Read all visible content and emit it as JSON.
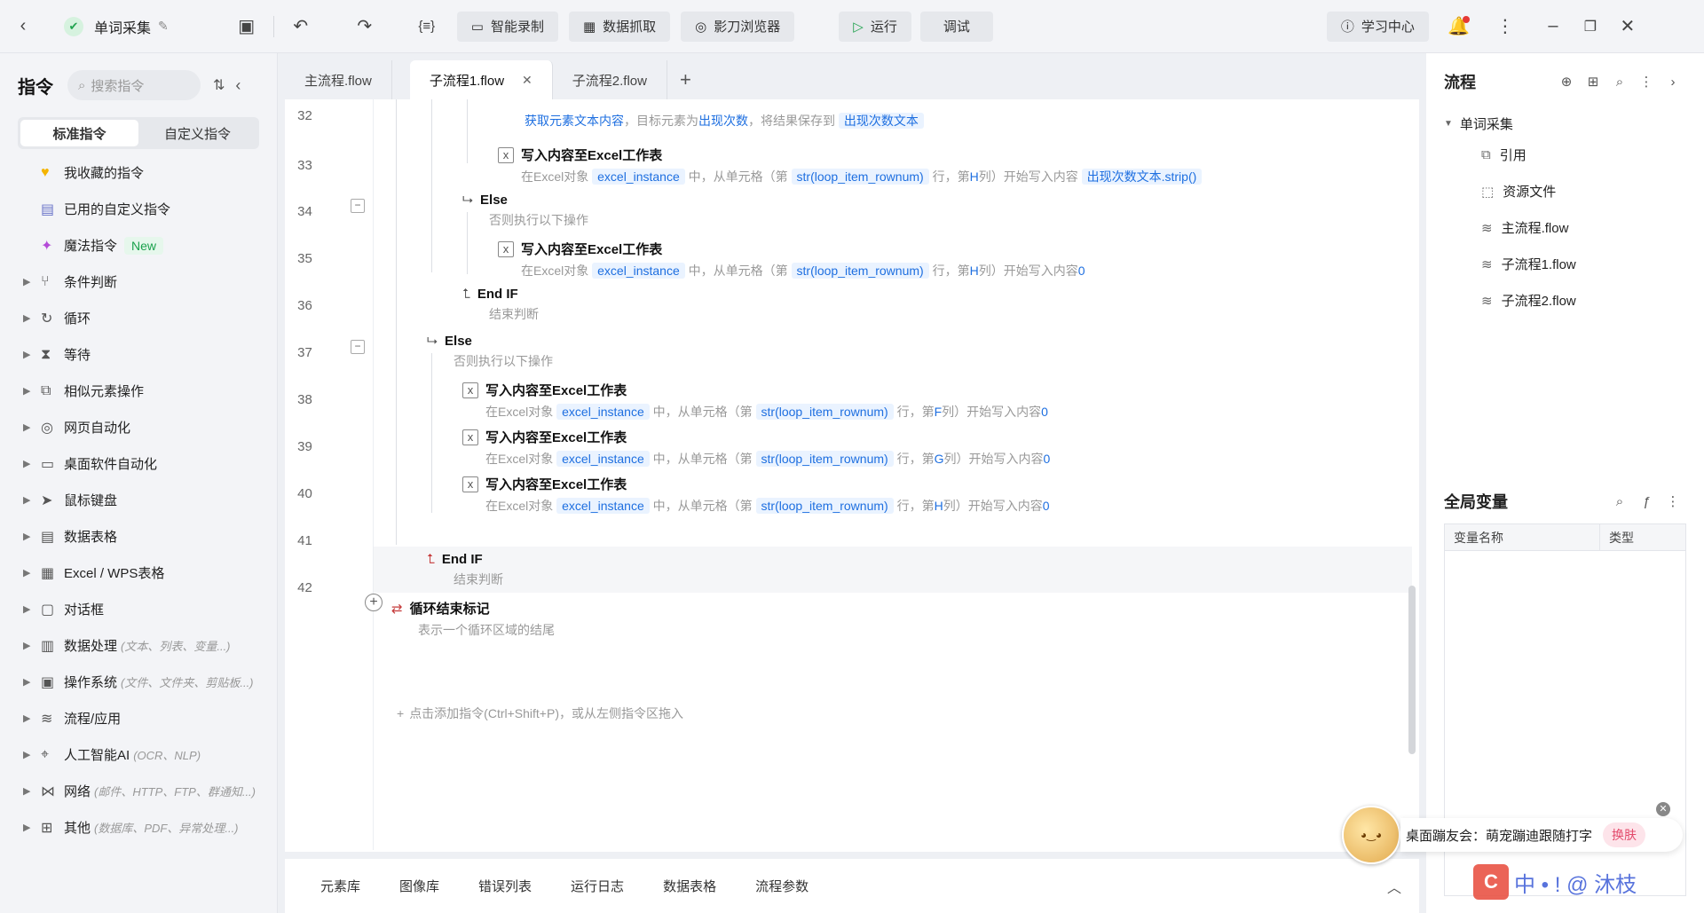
{
  "topbar": {
    "project_name": "单词采集",
    "record": "智能录制",
    "capture": "数据抓取",
    "browser": "影刀浏览器",
    "run": "运行",
    "debug": "调试",
    "learn": "学习中心"
  },
  "left": {
    "title": "指令",
    "search_placeholder": "搜索指令",
    "seg_standard": "标准指令",
    "seg_custom": "自定义指令",
    "items": [
      {
        "label": "我收藏的指令",
        "icon": "heart-icon",
        "arrow": false
      },
      {
        "label": "已用的自定义指令",
        "icon": "calendar-icon",
        "arrow": false
      },
      {
        "label": "魔法指令",
        "icon": "sparkle-icon",
        "arrow": false,
        "badge": "New"
      },
      {
        "label": "条件判断",
        "icon": "branch-icon",
        "arrow": true
      },
      {
        "label": "循环",
        "icon": "loop-icon",
        "arrow": true
      },
      {
        "label": "等待",
        "icon": "hourglass-icon",
        "arrow": true
      },
      {
        "label": "相似元素操作",
        "icon": "copy-icon",
        "arrow": true
      },
      {
        "label": "网页自动化",
        "icon": "chrome-icon",
        "arrow": true
      },
      {
        "label": "桌面软件自动化",
        "icon": "monitor-icon",
        "arrow": true
      },
      {
        "label": "鼠标键盘",
        "icon": "cursor-icon",
        "arrow": true
      },
      {
        "label": "数据表格",
        "icon": "table-icon",
        "arrow": true
      },
      {
        "label": "Excel / WPS表格",
        "icon": "excel-icon",
        "arrow": true
      },
      {
        "label": "对话框",
        "icon": "dialog-icon",
        "arrow": true
      },
      {
        "label": "数据处理",
        "icon": "data-icon",
        "arrow": true,
        "hint": "(文本、列表、变量...)"
      },
      {
        "label": "操作系统",
        "icon": "briefcase-icon",
        "arrow": true,
        "hint": "(文件、文件夹、剪贴板...)"
      },
      {
        "label": "流程/应用",
        "icon": "layers-icon",
        "arrow": true
      },
      {
        "label": "人工智能AI",
        "icon": "ai-icon",
        "arrow": true,
        "hint": "(OCR、NLP)"
      },
      {
        "label": "网络",
        "icon": "share-icon",
        "arrow": true,
        "hint": "(邮件、HTTP、FTP、群通知...)"
      },
      {
        "label": "其他",
        "icon": "grid-icon",
        "arrow": true,
        "hint": "(数据库、PDF、异常处理...)"
      }
    ]
  },
  "editor": {
    "tabs": [
      "主流程.flow",
      "子流程1.flow",
      "子流程2.flow"
    ],
    "add_hint": "点击添加指令(Ctrl+Shift+P)，或从左侧指令区拖入",
    "rows": {
      "r32": {
        "ln": "32",
        "desc_a": "获取元素文本内容",
        "desc_b": "，目标元素为",
        "desc_c": "出现次数",
        "desc_d": "，将结果保存到",
        "var": "出现次数文本"
      },
      "r33": {
        "ln": "33",
        "title": "写入内容至Excel工作表",
        "p1": "在Excel对象",
        "v1": "excel_instance",
        "p2": "中，从单元格（第",
        "v2": "str(loop_item_rownum)",
        "p3": "行，第",
        "col": "H",
        "p4": "列）开始写入内容",
        "v3": "出现次数文本.strip()"
      },
      "r34": {
        "ln": "34",
        "title": "Else",
        "desc": "否则执行以下操作"
      },
      "r35": {
        "ln": "35",
        "title": "写入内容至Excel工作表",
        "p1": "在Excel对象",
        "v1": "excel_instance",
        "p2": "中，从单元格（第",
        "v2": "str(loop_item_rownum)",
        "p3": "行，第",
        "col": "H",
        "p4": "列）开始写入内容",
        "val": "0"
      },
      "r36": {
        "ln": "36",
        "title": "End IF",
        "desc": "结束判断"
      },
      "r37": {
        "ln": "37",
        "title": "Else",
        "desc": "否则执行以下操作"
      },
      "r38": {
        "ln": "38",
        "title": "写入内容至Excel工作表",
        "p1": "在Excel对象",
        "v1": "excel_instance",
        "p2": "中，从单元格（第",
        "v2": "str(loop_item_rownum)",
        "p3": "行，第",
        "col": "F",
        "p4": "列）开始写入内容",
        "val": "0"
      },
      "r39": {
        "ln": "39",
        "title": "写入内容至Excel工作表",
        "p1": "在Excel对象",
        "v1": "excel_instance",
        "p2": "中，从单元格（第",
        "v2": "str(loop_item_rownum)",
        "p3": "行，第",
        "col": "G",
        "p4": "列）开始写入内容",
        "val": "0"
      },
      "r40": {
        "ln": "40",
        "title": "写入内容至Excel工作表",
        "p1": "在Excel对象",
        "v1": "excel_instance",
        "p2": "中，从单元格（第",
        "v2": "str(loop_item_rownum)",
        "p3": "行，第",
        "col": "H",
        "p4": "列）开始写入内容",
        "val": "0"
      },
      "r41": {
        "ln": "41",
        "title": "End IF",
        "desc": "结束判断"
      },
      "r42": {
        "ln": "42",
        "title": "循环结束标记",
        "desc": "表示一个循环区域的结尾"
      }
    }
  },
  "bottom": {
    "tabs": [
      "元素库",
      "图像库",
      "错误列表",
      "运行日志",
      "数据表格",
      "流程参数"
    ]
  },
  "right": {
    "title": "流程",
    "root": "单词采集",
    "items": [
      {
        "label": "引用",
        "icon": "copy-icon"
      },
      {
        "label": "资源文件",
        "icon": "puzzle-icon"
      },
      {
        "label": "主流程.flow",
        "icon": "layers-icon"
      },
      {
        "label": "子流程1.flow",
        "icon": "layers-icon"
      },
      {
        "label": "子流程2.flow",
        "icon": "layers-icon"
      }
    ],
    "gv_title": "全局变量",
    "col_name": "变量名称",
    "col_type": "类型"
  },
  "popup": {
    "text": "桌面蹦友会：萌宠蹦迪跟随打字",
    "skin": "换肤"
  },
  "watermark": {
    "text": "中 • ! @ 沐枝"
  }
}
